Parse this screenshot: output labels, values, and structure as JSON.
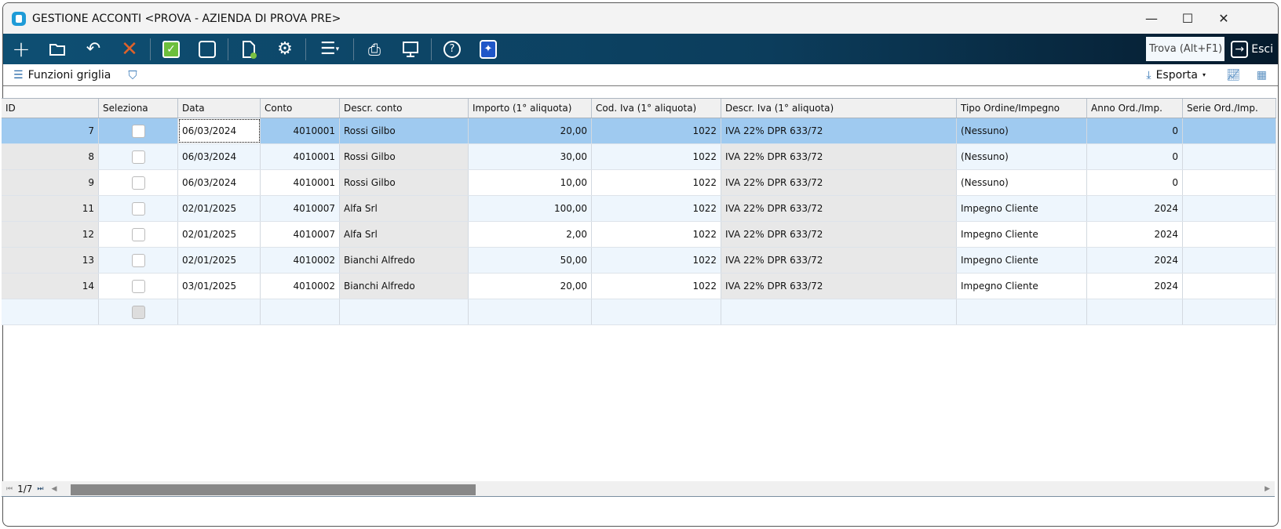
{
  "window": {
    "title": "GESTIONE ACCONTI <PROVA - AZIENDA DI PROVA PRE>",
    "minimize": "—",
    "maximize": "☐",
    "close": "✕"
  },
  "toolbar": {
    "search_placeholder": "Trova (Alt+F1)",
    "exit_label": "Esci"
  },
  "subbar": {
    "grid_functions": "Funzioni griglia",
    "export": "Esporta"
  },
  "grid": {
    "columns": [
      "ID",
      "Seleziona",
      "Data",
      "Conto",
      "Descr. conto",
      "Importo (1° aliquota)",
      "Cod. Iva (1° aliquota)",
      "Descr. Iva (1° aliquota)",
      "Tipo Ordine/Impegno",
      "Anno Ord./Imp.",
      "Serie Ord./Imp."
    ],
    "rows": [
      [
        "7",
        "",
        "06/03/2024",
        "4010001",
        "Rossi Gilbo",
        "20,00",
        "1022",
        "IVA 22% DPR 633/72",
        "(Nessuno)",
        "0",
        ""
      ],
      [
        "8",
        "",
        "06/03/2024",
        "4010001",
        "Rossi Gilbo",
        "30,00",
        "1022",
        "IVA 22% DPR 633/72",
        "(Nessuno)",
        "0",
        ""
      ],
      [
        "9",
        "",
        "06/03/2024",
        "4010001",
        "Rossi Gilbo",
        "10,00",
        "1022",
        "IVA 22% DPR 633/72",
        "(Nessuno)",
        "0",
        ""
      ],
      [
        "11",
        "",
        "02/01/2025",
        "4010007",
        "Alfa Srl",
        "100,00",
        "1022",
        "IVA 22% DPR 633/72",
        "Impegno Cliente",
        "2024",
        ""
      ],
      [
        "12",
        "",
        "02/01/2025",
        "4010007",
        "Alfa Srl",
        "2,00",
        "1022",
        "IVA 22% DPR 633/72",
        "Impegno Cliente",
        "2024",
        ""
      ],
      [
        "13",
        "",
        "02/01/2025",
        "4010002",
        "Bianchi Alfredo",
        "50,00",
        "1022",
        "IVA 22% DPR 633/72",
        "Impegno Cliente",
        "2024",
        ""
      ],
      [
        "14",
        "",
        "03/01/2025",
        "4010002",
        "Bianchi Alfredo",
        "20,00",
        "1022",
        "IVA 22% DPR 633/72",
        "Impegno Cliente",
        "2024",
        ""
      ]
    ],
    "pager": "1/7"
  },
  "colors": {
    "selected_row": "#9fcaf0",
    "toolbar": "#0e4f73"
  }
}
